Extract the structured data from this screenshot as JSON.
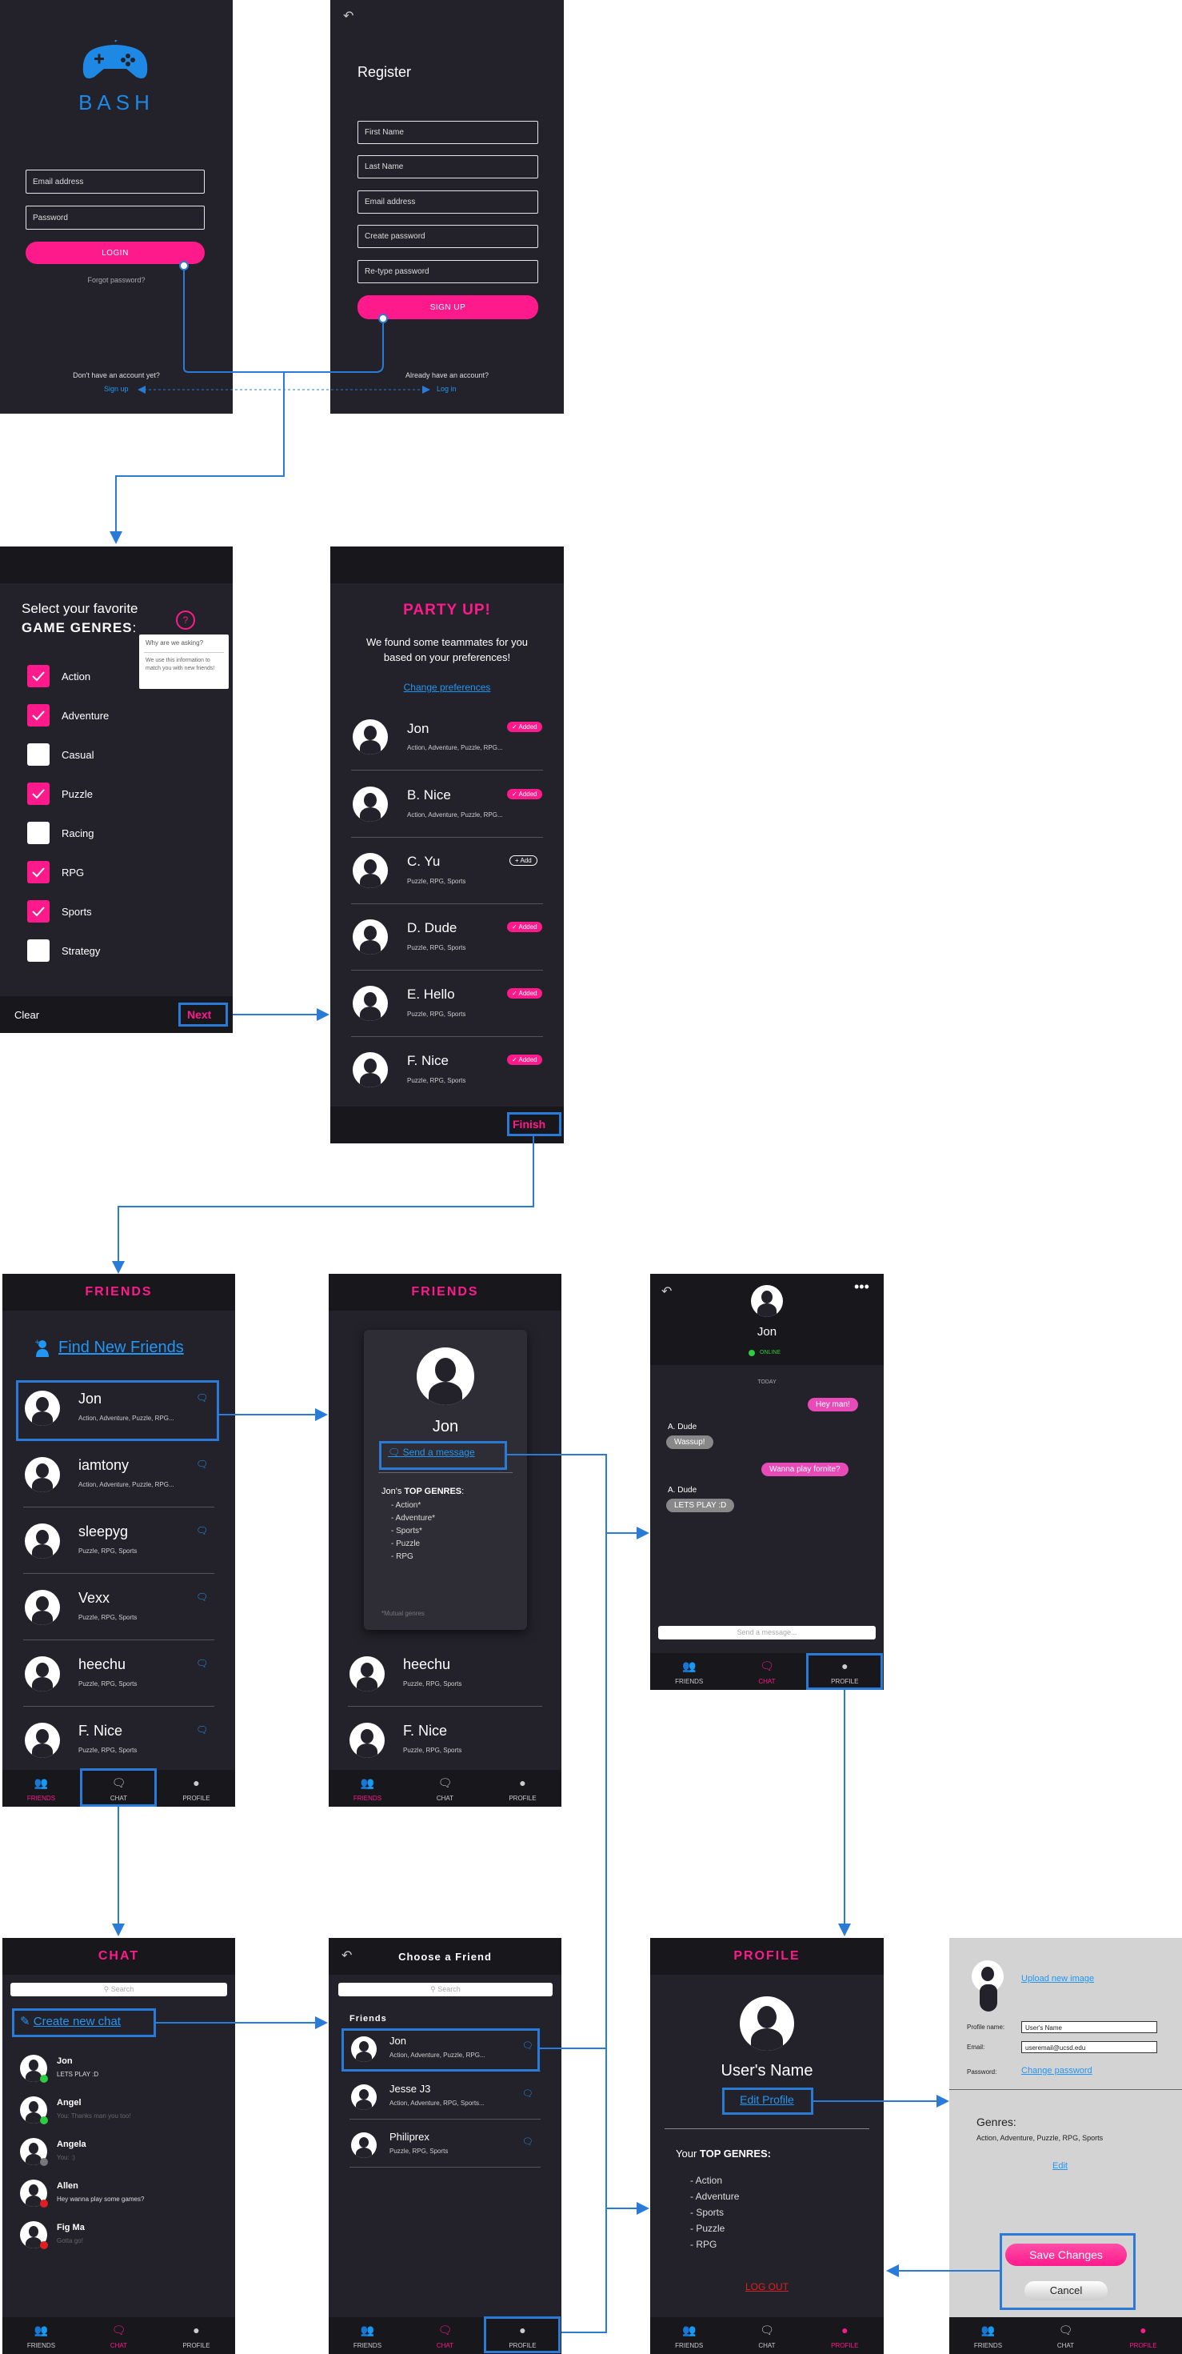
{
  "login": {
    "app_name": "BASH",
    "email_placeholder": "Email address",
    "password_placeholder": "Password",
    "login_button": "LOGIN",
    "forgot": "Forgot password?",
    "no_account": "Don't have an account yet?",
    "signup_link": "Sign up"
  },
  "register": {
    "back_icon": "back-arrow-icon",
    "title": "Register",
    "fields": [
      "First Name",
      "Last Name",
      "Email address",
      "Create password",
      "Re-type password"
    ],
    "signup_button": "SIGN UP",
    "have_account": "Already have an account?",
    "login_link": "Log in"
  },
  "genres": {
    "title_line1": "Select your favorite",
    "title_line2": "GAME GENRES",
    "colon": ":",
    "help_mark": "?",
    "tooltip_title": "Why are we asking?",
    "tooltip_body": "We use this information to match you with new friends!",
    "items": [
      {
        "label": "Action",
        "checked": true
      },
      {
        "label": "Adventure",
        "checked": true
      },
      {
        "label": "Casual",
        "checked": false
      },
      {
        "label": "Puzzle",
        "checked": true
      },
      {
        "label": "Racing",
        "checked": false
      },
      {
        "label": "RPG",
        "checked": true
      },
      {
        "label": "Sports",
        "checked": true
      },
      {
        "label": "Strategy",
        "checked": false
      }
    ],
    "clear": "Clear",
    "next": "Next"
  },
  "party": {
    "title": "PARTY UP!",
    "subtitle_line1": "We found some teammates for you",
    "subtitle_line2": "based on your preferences!",
    "change_prefs": "Change preferences",
    "added_label": "✓ Added",
    "add_label": "+ Add",
    "members": [
      {
        "name": "Jon",
        "genres": "Action, Adventure, Puzzle, RPG...",
        "added": true
      },
      {
        "name": "B. Nice",
        "genres": "Action, Adventure, Puzzle, RPG...",
        "added": true
      },
      {
        "name": "C. Yu",
        "genres": "Puzzle, RPG, Sports",
        "added": false
      },
      {
        "name": "D. Dude",
        "genres": "Puzzle, RPG, Sports",
        "added": true
      },
      {
        "name": "E. Hello",
        "genres": "Puzzle, RPG, Sports",
        "added": true
      },
      {
        "name": "F. Nice",
        "genres": "Puzzle, RPG, Sports",
        "added": true
      }
    ],
    "finish": "Finish"
  },
  "friends": {
    "title": "FRIENDS",
    "find_new": "Find New Friends",
    "list": [
      {
        "name": "Jon",
        "genres": "Action, Adventure, Puzzle, RPG..."
      },
      {
        "name": "iamtony",
        "genres": "Action, Adventure, Puzzle, RPG..."
      },
      {
        "name": "sleepyg",
        "genres": "Puzzle, RPG, Sports"
      },
      {
        "name": "Vexx",
        "genres": "Puzzle, RPG, Sports"
      },
      {
        "name": "heechu",
        "genres": "Puzzle, RPG, Sports"
      },
      {
        "name": "F. Nice",
        "genres": "Puzzle, RPG, Sports"
      }
    ]
  },
  "nav": {
    "friends": "FRIENDS",
    "chat": "CHAT",
    "profile": "PROFILE"
  },
  "popup": {
    "name": "Jon",
    "send_message": "Send a message",
    "top_genres_prefix": "Jon's ",
    "top_genres_bold": "TOP GENRES",
    "genres": [
      "- Action*",
      "- Adventure*",
      "- Sports*",
      "- Puzzle",
      "- RPG"
    ],
    "footnote": "*Mutual genres"
  },
  "chatview": {
    "name": "Jon",
    "status": "ONLINE",
    "day": "TODAY",
    "messages": [
      {
        "from": "me",
        "text": "Hey man!"
      },
      {
        "from": "other",
        "sender": "A. Dude",
        "text": "Wassup!"
      },
      {
        "from": "me",
        "text": "Wanna play fornite?"
      },
      {
        "from": "other",
        "sender": "A. Dude",
        "text": "LETS PLAY :D"
      }
    ],
    "input_placeholder": "Send a message..."
  },
  "chatlist": {
    "title": "CHAT",
    "search": "Search",
    "create": "Create new chat",
    "items": [
      {
        "name": "Jon",
        "preview": "LETS PLAY :D",
        "status": "#2ecc40"
      },
      {
        "name": "Angel",
        "preview": "You: Thanks man you too!",
        "status": "#2ecc40"
      },
      {
        "name": "Angela",
        "preview": "You: :)",
        "status": "#777777"
      },
      {
        "name": "Allen",
        "preview": "Hey wanna play some games?",
        "status": "#e02020"
      },
      {
        "name": "Fig Ma",
        "preview": "Gotta go!",
        "status": "#e02020"
      }
    ]
  },
  "choose": {
    "title": "Choose a Friend",
    "search": "Search",
    "section": "Friends",
    "list": [
      {
        "name": "Jon",
        "genres": "Action, Adventure, Puzzle, RPG..."
      },
      {
        "name": "Jesse J3",
        "genres": "Action, Adventure, RPG, Sports..."
      },
      {
        "name": "Philiprex",
        "genres": "Puzzle, RPG, Sports"
      }
    ]
  },
  "profile": {
    "title": "PROFILE",
    "user_name": "User's Name",
    "edit": "Edit Profile",
    "your": "Your ",
    "top_genres": "TOP GENRES:",
    "genres": [
      "- Action",
      "- Adventure",
      "- Sports",
      "- Puzzle",
      "- RPG"
    ],
    "logout": "LOG OUT"
  },
  "edit": {
    "upload": "Upload new image",
    "name_label": "Profile name:",
    "name_value": "User's Name",
    "email_label": "Email:",
    "email_value": "useremail@ucsd.edu",
    "password_label": "Password:",
    "change_password": "Change password",
    "genres_label": "Genres:",
    "genres_value": "Action, Adventure, Puzzle, RPG, Sports",
    "edit_link": "Edit",
    "save": "Save Changes",
    "cancel": "Cancel"
  },
  "colors": {
    "accent": "#ff1a8c",
    "link": "#2196f3",
    "screen_bg": "#23222a",
    "flow": "#2a7bd8"
  }
}
